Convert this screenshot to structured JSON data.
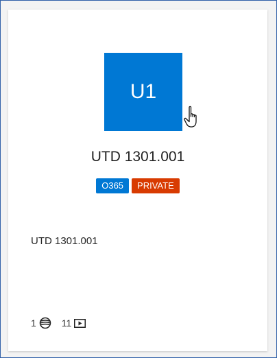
{
  "card": {
    "thumbnail_text": "U1",
    "title": "UTD 1301.001",
    "badges": [
      {
        "label": "O365",
        "color": "#0078d4"
      },
      {
        "label": "PRIVATE",
        "color": "#d83b01"
      }
    ],
    "description": "UTD 1301.001",
    "stats": {
      "channels_count": "1",
      "channels_icon": "channel-globe-icon",
      "videos_count": "11",
      "videos_icon": "video-play-icon"
    }
  },
  "cursor_icon": "hand-pointer-icon",
  "colors": {
    "accent": "#0078d4",
    "private": "#d83b01",
    "frame_border": "#2f5fa8"
  }
}
